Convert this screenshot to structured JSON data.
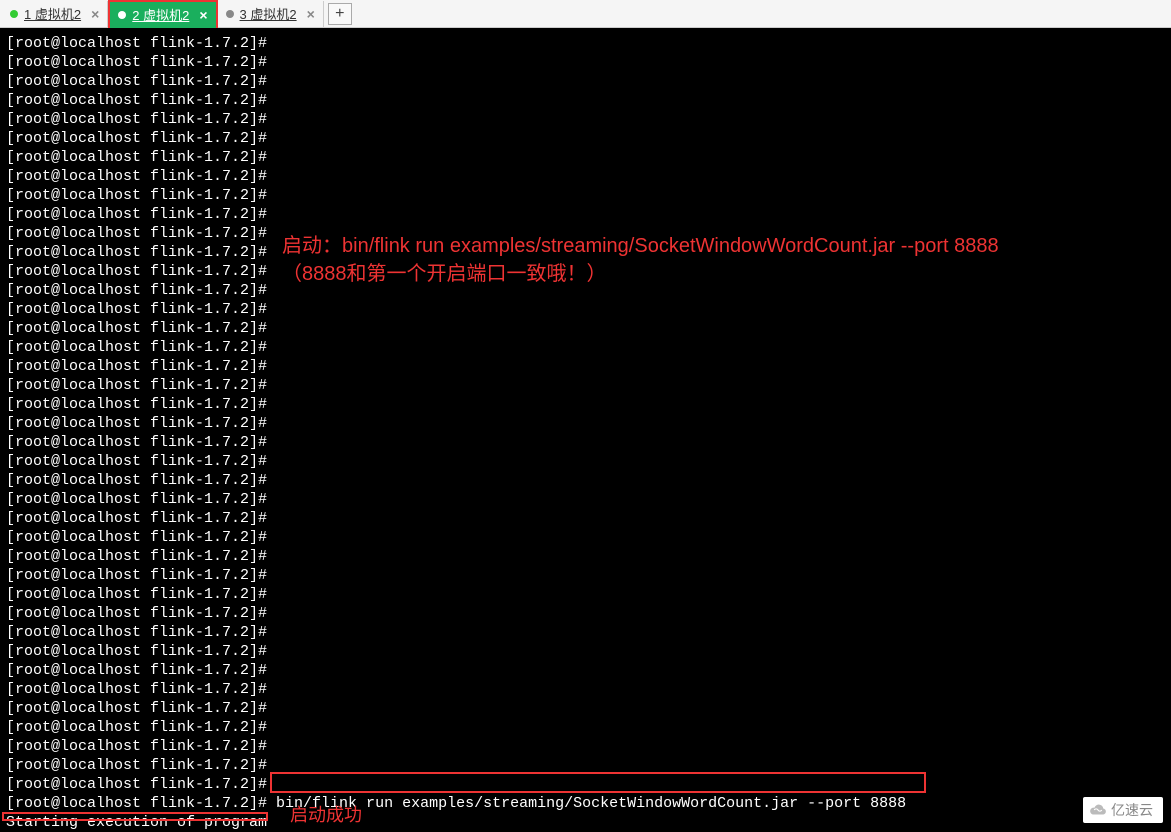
{
  "tabs": [
    {
      "label": "1 虚拟机2",
      "active": false,
      "dotClass": ""
    },
    {
      "label": "2 虚拟机2",
      "active": true,
      "dotClass": ""
    },
    {
      "label": "3 虚拟机2",
      "active": false,
      "dotClass": "inactive"
    }
  ],
  "add_tab_label": "+",
  "close_glyph": "×",
  "terminal": {
    "prompt": "[root@localhost flink-1.7.2]#",
    "empty_prompt_count": 40,
    "command": "bin/flink run examples/streaming/SocketWindowWordCount.jar --port 8888",
    "output": "Starting execution of program"
  },
  "annotation_top_line1": "启动：bin/flink run examples/streaming/SocketWindowWordCount.jar --port 8888",
  "annotation_top_line2": "（8888和第一个开启端口一致哦！）",
  "annotation_bottom": "启动成功",
  "watermark": "亿速云"
}
